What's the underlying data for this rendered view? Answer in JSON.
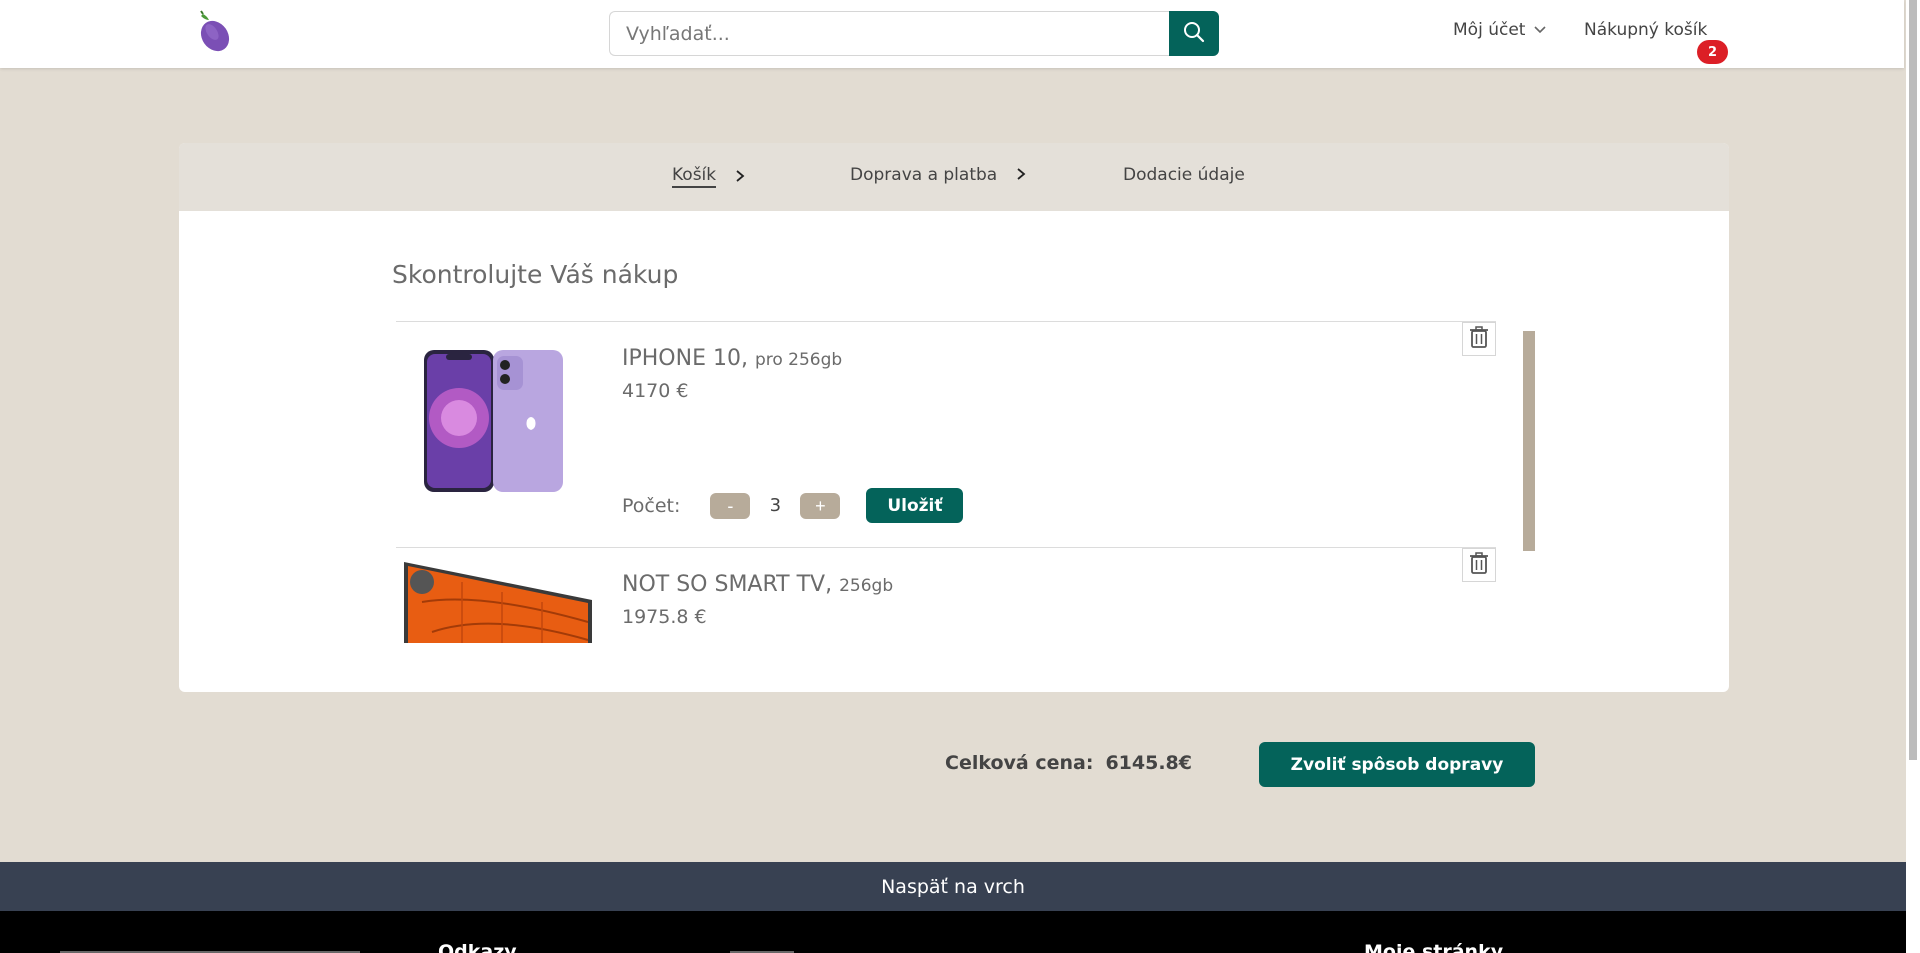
{
  "header": {
    "logo_icon": "eggplant-icon",
    "search": {
      "placeholder": "Vyhľadať...",
      "value": "",
      "button_icon": "search-icon"
    },
    "account_label": "Môj účet",
    "cart_label": "Nákupný košík",
    "cart_count": "2"
  },
  "checkout": {
    "steps": [
      {
        "label": "Košík",
        "active": true
      },
      {
        "label": "Doprava a platba",
        "active": false
      },
      {
        "label": "Dodacie údaje",
        "active": false
      }
    ],
    "title": "Skontrolujte Váš nákup",
    "items": [
      {
        "name": "IPHONE 10,",
        "variant": "pro 256gb",
        "price": "4170 €",
        "quantity_label": "Počet:",
        "quantity": "3",
        "minus_label": "-",
        "plus_label": "+",
        "save_label": "Uložiť",
        "image_icon": "iphone-image",
        "delete_icon": "trash-icon"
      },
      {
        "name": "NOT SO SMART TV,",
        "variant": "256gb",
        "price": "1975.8 €",
        "image_icon": "tv-image",
        "delete_icon": "trash-icon"
      }
    ],
    "total_label": "Celková cena:",
    "total_value": "6145.8€",
    "next_button_label": "Zvoliť spôsob dopravy"
  },
  "footer": {
    "back_to_top_label": "Naspäť na vrch",
    "headings": [
      "Odkazy",
      "Moje stránky"
    ]
  },
  "colors": {
    "accent": "#04635a",
    "background": "#e2dcd2",
    "badge": "#dc1f26",
    "qty_button": "#b7ab9a",
    "back_to_top": "#384152"
  }
}
